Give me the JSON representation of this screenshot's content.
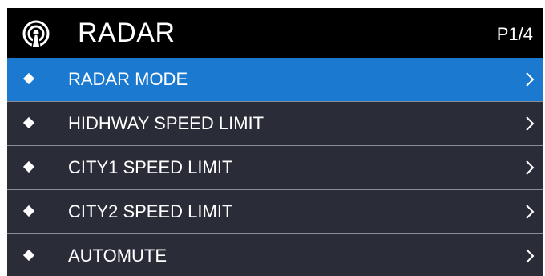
{
  "header": {
    "icon": "radar-icon",
    "title": "RADAR",
    "page_indicator": "P1/4"
  },
  "colors": {
    "header_bg": "#000000",
    "list_bg": "#2a2c38",
    "selected_bg": "#1b7ad0",
    "divider": "#8a8c96",
    "text": "#ffffff"
  },
  "menu": {
    "items": [
      {
        "label": "RADAR MODE",
        "selected": true,
        "bullet_icon": "diamond-icon",
        "chevron_icon": "chevron-right-icon"
      },
      {
        "label": "HIDHWAY SPEED LIMIT",
        "selected": false,
        "bullet_icon": "diamond-icon",
        "chevron_icon": "chevron-right-icon"
      },
      {
        "label": "CITY1 SPEED LIMIT",
        "selected": false,
        "bullet_icon": "diamond-icon",
        "chevron_icon": "chevron-right-icon"
      },
      {
        "label": "CITY2 SPEED LIMIT",
        "selected": false,
        "bullet_icon": "diamond-icon",
        "chevron_icon": "chevron-right-icon"
      },
      {
        "label": "AUTOMUTE",
        "selected": false,
        "bullet_icon": "diamond-icon",
        "chevron_icon": "chevron-right-icon"
      }
    ]
  }
}
